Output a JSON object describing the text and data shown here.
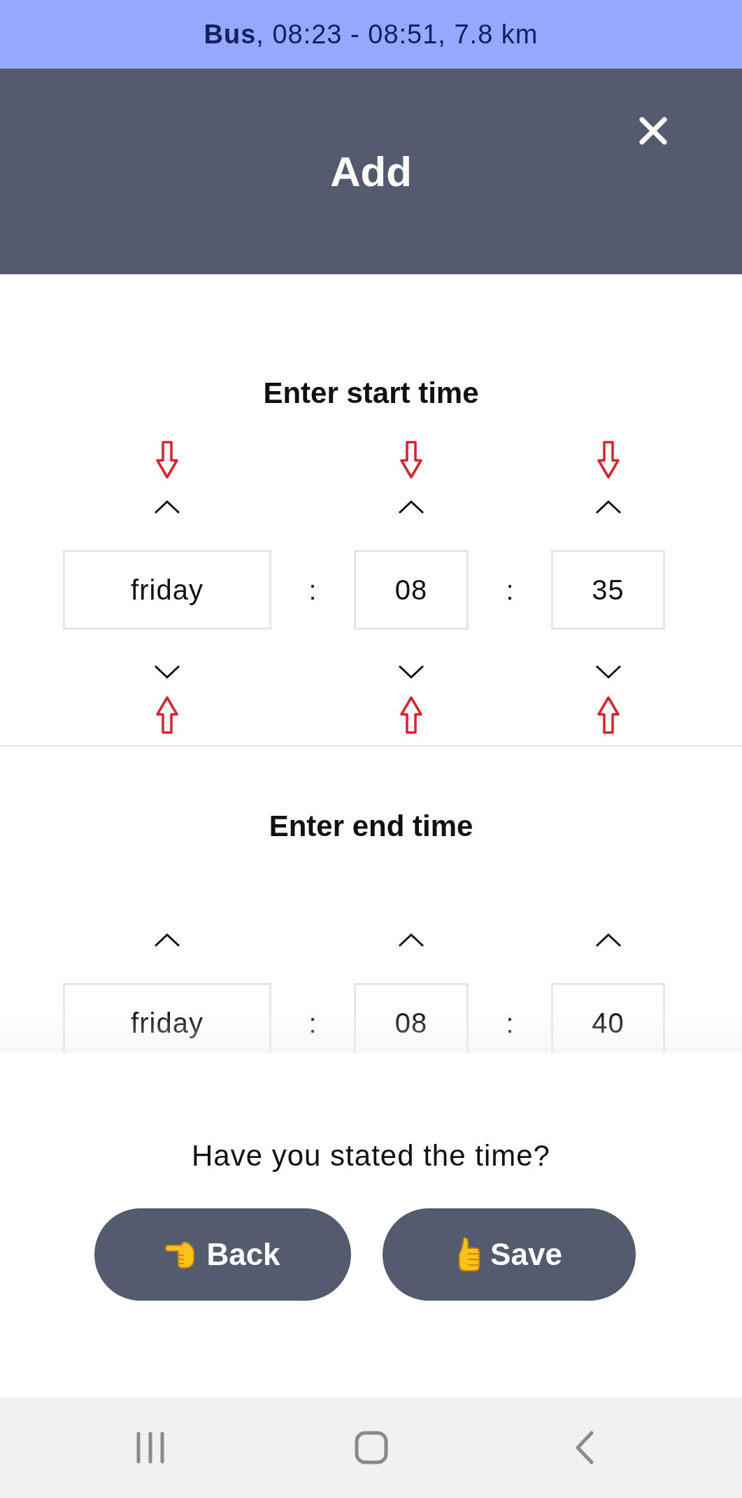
{
  "trip_banner": {
    "text": "**Bus**, 08:23 - 08:51, 7.8 km"
  },
  "dialog": {
    "title": "Add"
  },
  "sections": [
    {
      "heading": "Enter start time",
      "hints_shown": true,
      "fields": [
        {
          "kind": "day",
          "value": "friday"
        },
        {
          "kind": "hour",
          "value": "08"
        },
        {
          "kind": "minute",
          "value": "35"
        }
      ],
      "separators": [
        ":",
        ":"
      ]
    },
    {
      "heading": "Enter end time",
      "hints_shown": false,
      "fields": [
        {
          "kind": "day",
          "value": "friday"
        },
        {
          "kind": "hour",
          "value": "08"
        },
        {
          "kind": "minute",
          "value": "40"
        }
      ],
      "separators": [
        ":",
        ":"
      ]
    }
  ],
  "confirm": {
    "question": "Have you stated the time?",
    "buttons": [
      {
        "kind": "back",
        "label": "Back"
      },
      {
        "kind": "save",
        "label": "Save"
      }
    ]
  }
}
